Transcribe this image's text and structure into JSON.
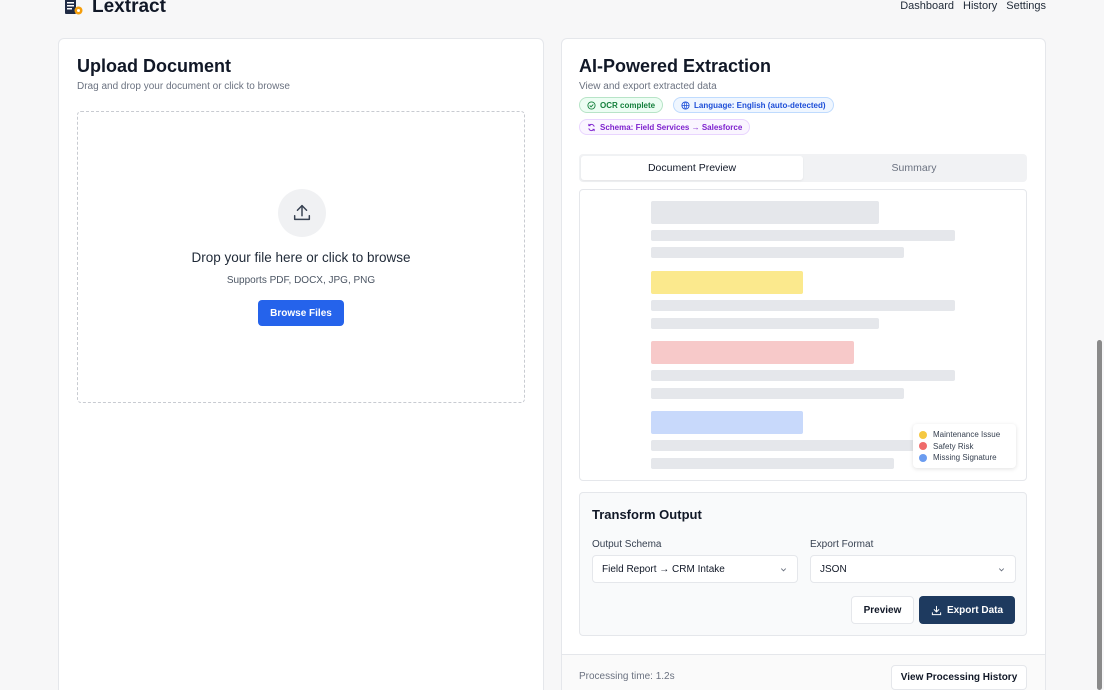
{
  "app": {
    "name": "Lextract"
  },
  "nav": {
    "items": [
      "Dashboard",
      "History",
      "Settings"
    ]
  },
  "upload": {
    "title": "Upload Document",
    "subtitle": "Drag and drop your document or click to browse",
    "drop_title": "Drop your file here or click to browse",
    "drop_sub": "Supports PDF, DOCX, JPG, PNG",
    "browse_label": "Browse Files"
  },
  "extraction": {
    "title": "AI-Powered Extraction",
    "subtitle": "View and export extracted data",
    "chips": {
      "ocr": "OCR complete",
      "language": "Language: English (auto-detected)",
      "schema": "Schema: Field Services → Salesforce"
    },
    "tabs": [
      "Document Preview",
      "Summary"
    ],
    "legend": [
      {
        "label": "Maintenance Issue",
        "color": "#f5c842"
      },
      {
        "label": "Safety Risk",
        "color": "#ef6b6b"
      },
      {
        "label": "Missing Signature",
        "color": "#6b9cf0"
      }
    ],
    "highlight_colors": {
      "yellow": "#fbe98d",
      "red": "#f7c9c9",
      "blue": "#c8d9fb"
    }
  },
  "transform": {
    "title": "Transform Output",
    "schema_label": "Output Schema",
    "schema_value": "Field Report → CRM Intake",
    "format_label": "Export Format",
    "format_value": "JSON",
    "preview_label": "Preview",
    "export_label": "Export Data"
  },
  "footer": {
    "processing_time": "Processing time: 1.2s",
    "history_label": "View Processing History"
  },
  "colors": {
    "primary": "#2563eb",
    "export": "#1e3a5f"
  }
}
